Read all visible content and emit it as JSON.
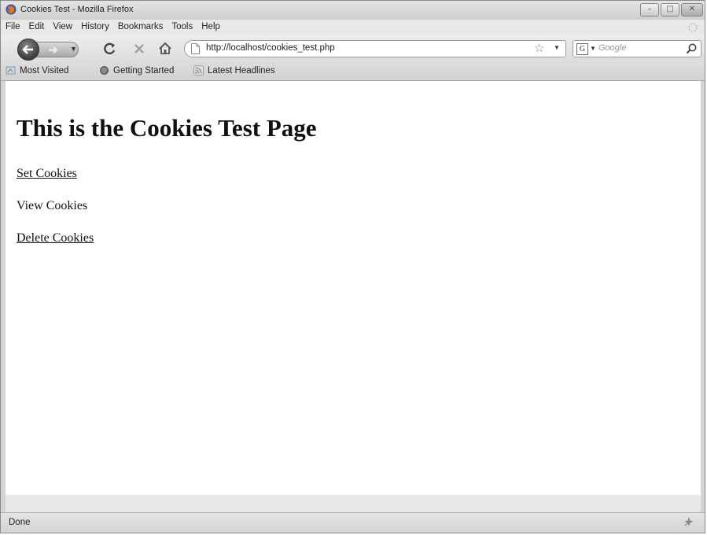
{
  "window": {
    "title": "Cookies Test - Mozilla Firefox"
  },
  "menu": {
    "items": [
      "File",
      "Edit",
      "View",
      "History",
      "Bookmarks",
      "Tools",
      "Help"
    ]
  },
  "navigation": {
    "url": "http://localhost/cookies_test.php",
    "search_engine_placeholder": "Google",
    "search_engine_letter": "G"
  },
  "bookmarks": {
    "items": [
      "Most Visited",
      "Getting Started",
      "Latest Headlines"
    ]
  },
  "page": {
    "heading": "This is the Cookies Test Page",
    "links": [
      "Set Cookies",
      "View Cookies",
      "Delete Cookies"
    ]
  },
  "status": {
    "text": "Done"
  },
  "icons": {
    "firefox": "firefox-logo-icon",
    "back": "back-arrow-icon",
    "forward": "forward-arrow-icon",
    "reload": "reload-icon",
    "stop": "stop-icon",
    "home": "home-icon",
    "page": "page-icon",
    "bookmark_star": "star-icon",
    "search": "magnifier-icon"
  },
  "colors": {
    "chrome": "#e8e8e8",
    "content_bg": "#ffffff",
    "text": "#111111"
  }
}
